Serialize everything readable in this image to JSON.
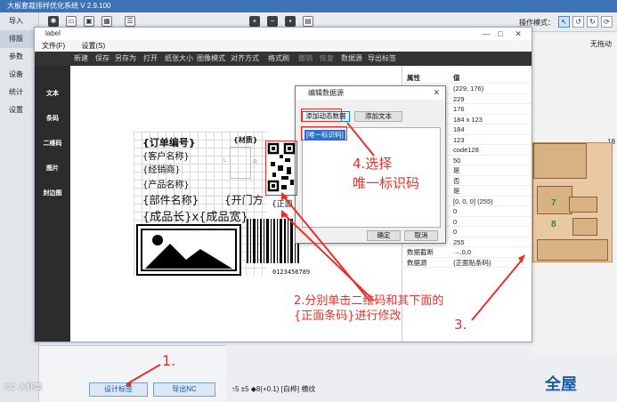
{
  "app": {
    "title": "大板套裁排样优化系统 V 2.9.100",
    "operation_mode_label": "操作模式：",
    "no_drag": "无拖动",
    "side_nav": [
      "导入",
      "排版",
      "参数",
      "设备",
      "统计",
      "设置"
    ],
    "bottom_buttons": {
      "design_label": "设计标签",
      "export_nc": "导出NC"
    },
    "status": "↑5 ±5 ◆8(+0.1)  [白桦]  横纹",
    "logo": "全屋",
    "watermark": "CC 大虾集",
    "side_number": "18",
    "pieces": [
      "7",
      "8"
    ]
  },
  "label_window": {
    "title": "label",
    "menu": [
      "文件(F)",
      "设置(S)"
    ],
    "toolbar": [
      "新建",
      "保存",
      "另存为",
      "打开",
      "纸张大小",
      "图像模式",
      "对齐方式",
      "格式刷",
      "撤销",
      "恢复",
      "数据源",
      "导出标签"
    ],
    "side_tools": [
      "文本",
      "条码",
      "二维码",
      "图片",
      "封边图"
    ],
    "label": {
      "order_no": "{订单编号}",
      "material": "{材质}",
      "customer": "{客户名称}",
      "dealer": "{经销商}",
      "product": "{产品名称}",
      "part": "{部件名称}",
      "door": "{开门方",
      "front_code": "{正面",
      "size": "{成品长}x{成品宽}",
      "barcode_digits": "0123456789"
    },
    "edge_marks": [
      "L",
      "R"
    ]
  },
  "properties": {
    "header": {
      "key": "属性",
      "value": "值"
    },
    "rows": [
      {
        "key": "",
        "value": "(229, 176)"
      },
      {
        "key": "",
        "value": "229"
      },
      {
        "key": "",
        "value": "176"
      },
      {
        "key": "",
        "value": "184 x 123"
      },
      {
        "key": "",
        "value": "184"
      },
      {
        "key": "",
        "value": "123"
      },
      {
        "key": "",
        "value": "code128"
      },
      {
        "key": "",
        "value": "50"
      },
      {
        "key": "",
        "value": "是"
      },
      {
        "key": "",
        "value": "否"
      },
      {
        "key": "",
        "value": "是"
      },
      {
        "key": "",
        "value": "[0, 0, 0] (255)"
      },
      {
        "key": "",
        "value": "0"
      },
      {
        "key": "",
        "value": "0"
      },
      {
        "key": "",
        "value": "0"
      },
      {
        "key": "",
        "value": "255"
      },
      {
        "key": "数据截断",
        "value": "→,0,0"
      },
      {
        "key": "数据源",
        "value": "{正面贴条码}"
      }
    ]
  },
  "dialog": {
    "title": "编辑数据源",
    "add_dynamic": "添加动态数据",
    "add_text": "添加文本",
    "list_item": "[唯一标识码]",
    "ok": "确定",
    "cancel": "取消"
  },
  "annotations": {
    "step1": "1.",
    "step2": "2.分别单击二维码和其下面的\n{正面条码}进行修改",
    "step3": "3.",
    "step4": "4.选择\n唯一标识码"
  },
  "colors": {
    "annotation": "#e8302b",
    "title_bar": "#3d73b5",
    "selection": "#2a6fd6",
    "wood": "#e8c9a3"
  }
}
